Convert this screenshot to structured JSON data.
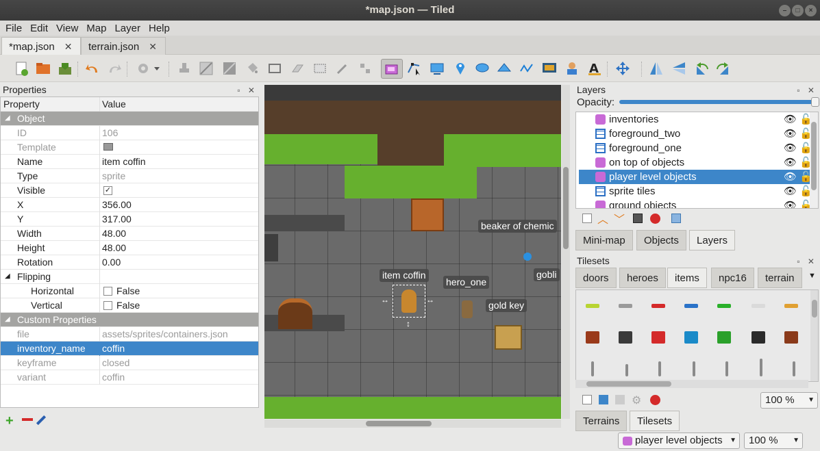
{
  "window": {
    "title": "*map.json — Tiled"
  },
  "menu": [
    "File",
    "Edit",
    "View",
    "Map",
    "Layer",
    "Help"
  ],
  "doc_tabs": [
    {
      "label": "*map.json",
      "active": true
    },
    {
      "label": "terrain.json",
      "active": false
    }
  ],
  "properties": {
    "title": "Properties",
    "col_property": "Property",
    "col_value": "Value",
    "group_object": "Object",
    "rows": [
      {
        "key": "ID",
        "value": "106",
        "dim": true
      },
      {
        "key": "Template",
        "value": "",
        "dim": true
      },
      {
        "key": "Name",
        "value": "item coffin"
      },
      {
        "key": "Type",
        "value": "sprite",
        "dimv": true
      },
      {
        "key": "Visible",
        "value": "✓"
      },
      {
        "key": "X",
        "value": "356.00"
      },
      {
        "key": "Y",
        "value": "317.00"
      },
      {
        "key": "Width",
        "value": "48.00"
      },
      {
        "key": "Height",
        "value": "48.00"
      },
      {
        "key": "Rotation",
        "value": "0.00"
      }
    ],
    "flipping": "Flipping",
    "horizontal": {
      "key": "Horizontal",
      "value": "False"
    },
    "vertical": {
      "key": "Vertical",
      "value": "False"
    },
    "group_custom": "Custom Properties",
    "custom": [
      {
        "key": "file",
        "value": "assets/sprites/containers.json"
      },
      {
        "key": "inventory_name",
        "value": "coffin"
      },
      {
        "key": "keyframe",
        "value": "closed"
      },
      {
        "key": "variant",
        "value": "coffin"
      }
    ]
  },
  "map_labels": {
    "beaker": "beaker of chemic",
    "item_coffin": "item coffin",
    "hero_one": "hero_one",
    "goblin": "gobli",
    "gold_key": "gold key"
  },
  "layers_panel": {
    "title": "Layers",
    "opacity_label": "Opacity:",
    "items": [
      {
        "label": "inventories",
        "type": "object"
      },
      {
        "label": "foreground_two",
        "type": "tile"
      },
      {
        "label": "foreground_one",
        "type": "tile"
      },
      {
        "label": "on top of objects",
        "type": "object"
      },
      {
        "label": "player level objects",
        "type": "object",
        "selected": true
      },
      {
        "label": "sprite tiles",
        "type": "tile"
      },
      {
        "label": "ground objects",
        "type": "object"
      }
    ],
    "tabs": [
      "Mini-map",
      "Objects",
      "Layers"
    ]
  },
  "tilesets_panel": {
    "title": "Tilesets",
    "tabs": [
      "doors",
      "heroes",
      "items",
      "npc16",
      "terrain"
    ],
    "active_tab": "items",
    "zoom": "100 %",
    "bottom_tabs": [
      "Terrains",
      "Tilesets"
    ]
  },
  "statusbar": {
    "layer": "player level objects",
    "zoom": "100 %"
  },
  "colors": {
    "accent": "#3d86c9",
    "grass": "#66b02e",
    "dirt": "#563e2a"
  }
}
